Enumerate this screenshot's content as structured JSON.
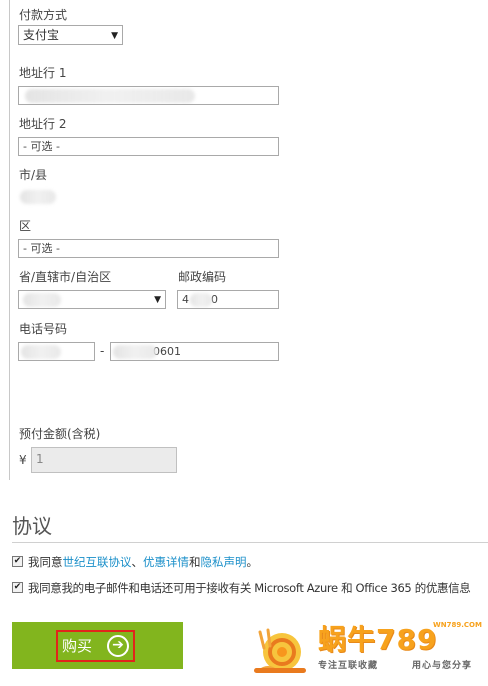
{
  "payment": {
    "method_label": "付款方式",
    "method_value": "支付宝"
  },
  "address": {
    "line1_label": "地址行 1",
    "line1_value": "",
    "line2_label": "地址行 2",
    "line2_placeholder": "- 可选 -",
    "city_label": "市/县",
    "district_label": "区",
    "district_placeholder": "- 可选 -",
    "province_label": "省/直辖市/自治区",
    "postal_label": "邮政编码",
    "postal_prefix": "4",
    "postal_suffix": "0",
    "phone_label": "电话号码",
    "phone_separator": "-",
    "phone_suffix": "0601"
  },
  "prepay": {
    "label": "预付金额(含税)",
    "currency": "¥",
    "value": "1"
  },
  "agreement": {
    "title": "协议",
    "item1_prefix": "我同意",
    "item1_link1": "世纪互联协议",
    "item1_sep1": "、",
    "item1_link2": "优惠详情",
    "item1_and": "和",
    "item1_link3": "隐私声明",
    "item1_end": "。",
    "item2_text": "我同意我的电子邮件和电话还可用于接收有关 Microsoft Azure 和 Office 365 的优惠信息"
  },
  "buy": {
    "label": "购买",
    "arrow_icon": "➔"
  },
  "watermark": {
    "brand": "蜗牛789",
    "domain": "WN789.COM",
    "slogan1": "专注互联收藏",
    "slogan2": "用心与您分享"
  }
}
